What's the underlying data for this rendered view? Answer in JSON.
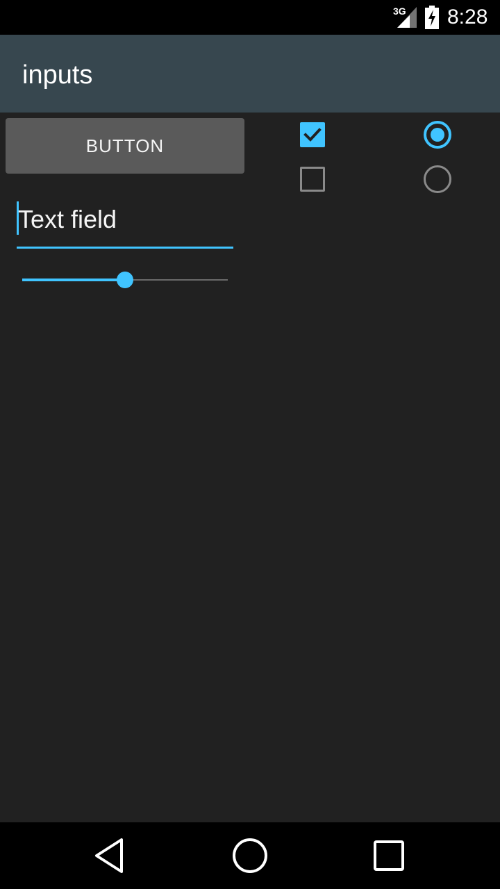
{
  "status_bar": {
    "network": "3G",
    "time": "8:28",
    "icons": [
      "signal-icon",
      "battery-charging-icon"
    ]
  },
  "app_bar": {
    "title": "inputs"
  },
  "main": {
    "button_label": "BUTTON",
    "text_field": {
      "value": "Text field"
    },
    "slider": {
      "value": 0.5
    },
    "checkboxes": [
      {
        "checked": true
      },
      {
        "checked": false
      }
    ],
    "radios": [
      {
        "selected": true
      },
      {
        "selected": false
      }
    ]
  },
  "nav_bar": {
    "icons": [
      "back-icon",
      "home-icon",
      "recents-icon"
    ]
  },
  "colors": {
    "accent": "#40c4ff",
    "app_bar": "#37474f",
    "background": "#212121",
    "button": "#5a5a5a"
  }
}
